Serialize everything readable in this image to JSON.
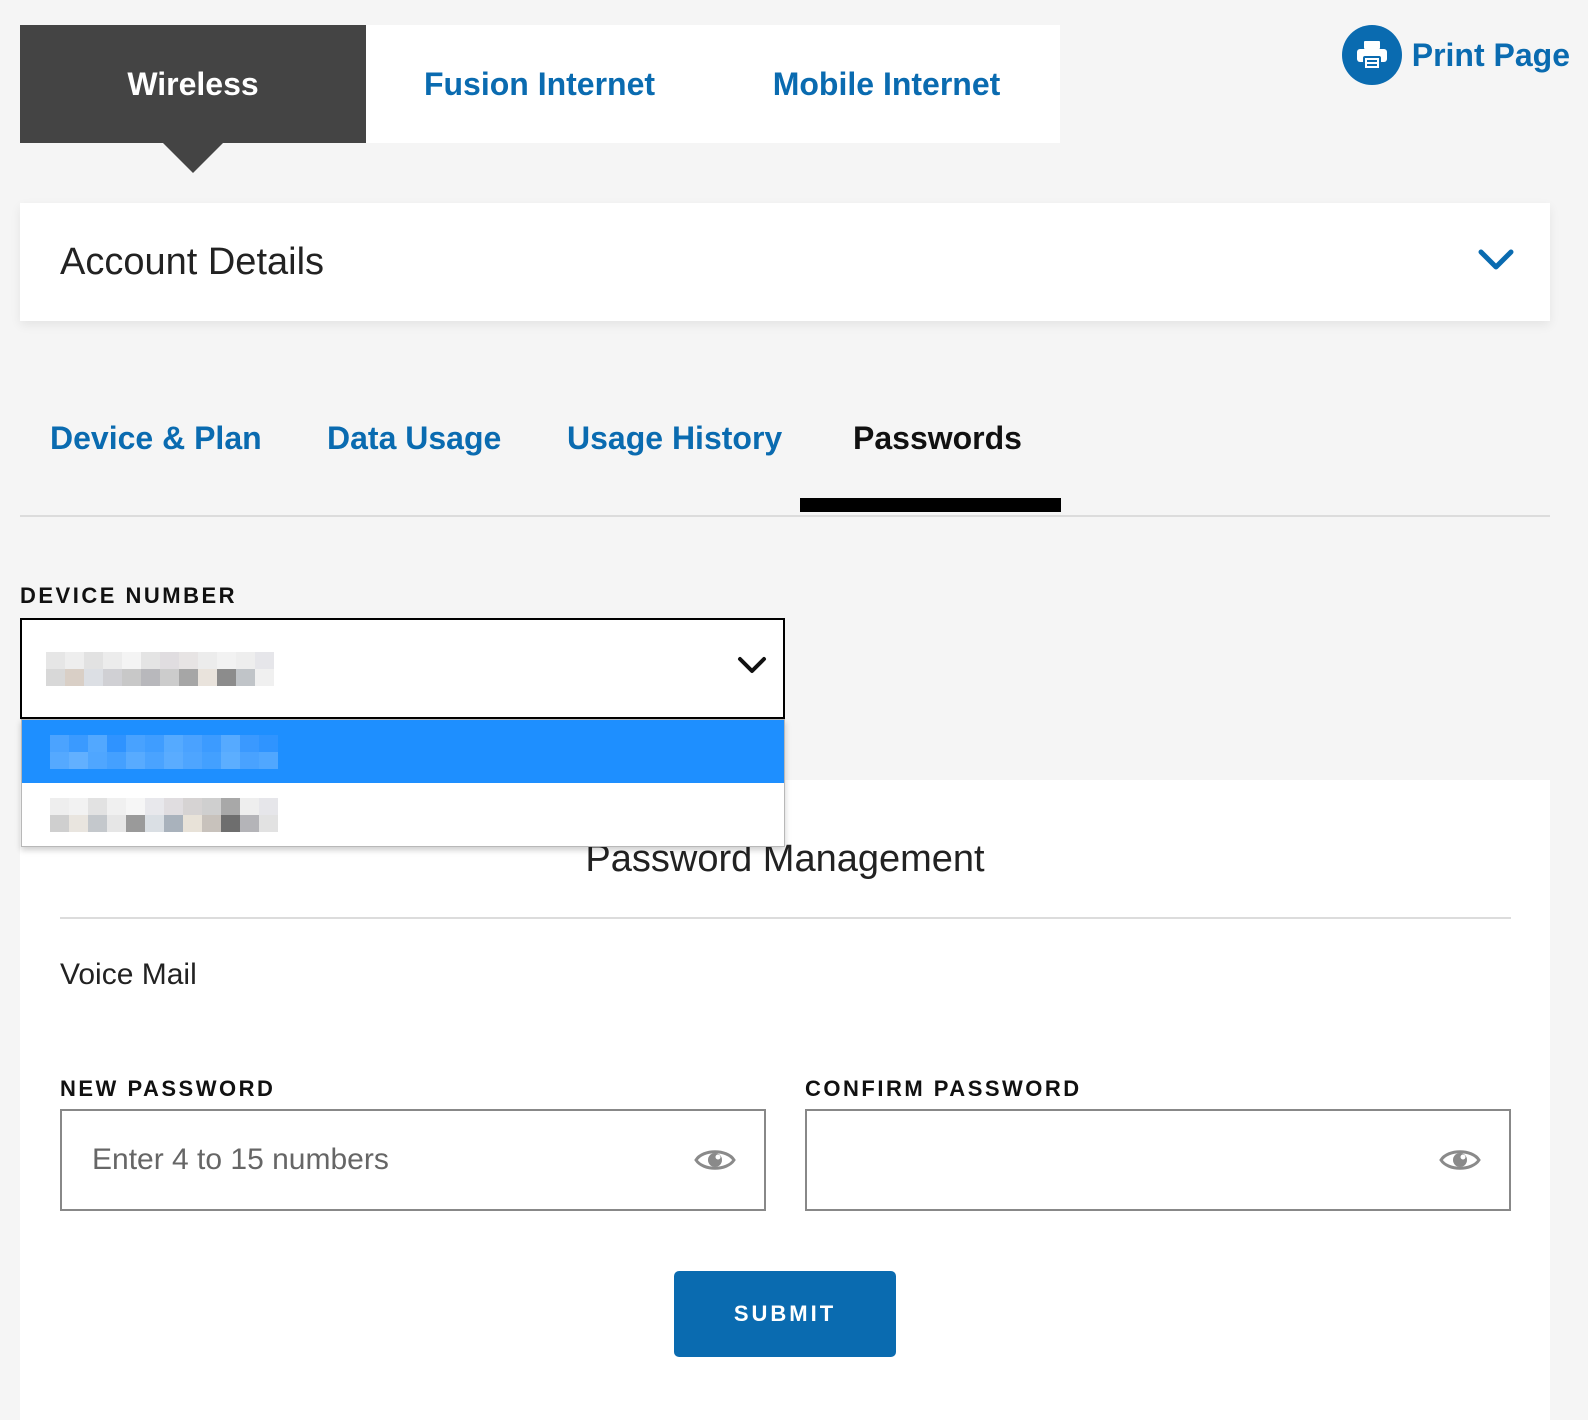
{
  "top_tabs": [
    {
      "label": "Wireless",
      "active": true
    },
    {
      "label": "Fusion Internet",
      "active": false
    },
    {
      "label": "Mobile Internet",
      "active": false
    }
  ],
  "print": {
    "label": "Print Page",
    "icon": "printer-icon"
  },
  "account_details": {
    "title": "Account Details",
    "icon": "chevron-down-icon"
  },
  "sub_tabs": [
    {
      "label": "Device & Plan",
      "active": false
    },
    {
      "label": "Data Usage",
      "active": false
    },
    {
      "label": "Usage History",
      "active": false
    },
    {
      "label": "Passwords",
      "active": true
    }
  ],
  "device_number": {
    "label": "DEVICE NUMBER",
    "selected_value_note": "redacted (pixelated)",
    "options_count_visible": 2,
    "highlighted_index": 0
  },
  "password_management": {
    "title": "Password Management",
    "section": "Voice Mail",
    "new_password": {
      "label": "NEW PASSWORD",
      "placeholder": "Enter 4 to 15 numbers",
      "value": ""
    },
    "confirm_password": {
      "label": "CONFIRM PASSWORD",
      "placeholder": "",
      "value": ""
    },
    "submit_label": "SUBMIT"
  },
  "colors": {
    "accent": "#0a6bb0",
    "active_tab_bg": "#444444",
    "dropdown_highlight": "#1e8fff",
    "page_bg": "#f5f5f5"
  }
}
